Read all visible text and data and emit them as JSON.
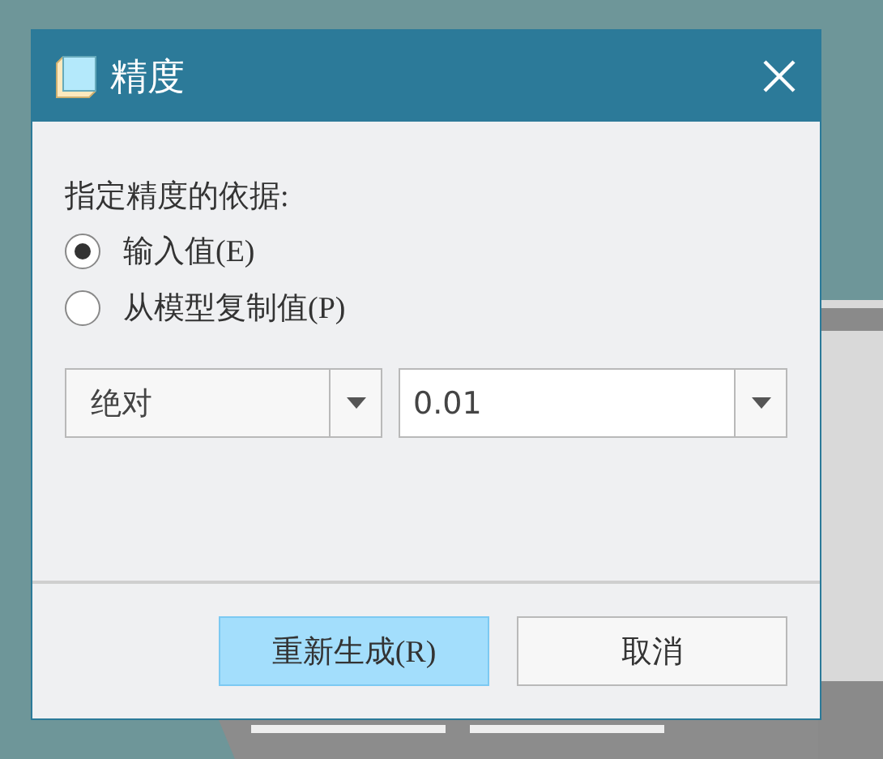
{
  "window": {
    "title": "精度"
  },
  "prompt": "指定精度的依据:",
  "options": [
    {
      "label": "输入值(E)",
      "selected": true
    },
    {
      "label": "从模型复制值(P)",
      "selected": false
    }
  ],
  "type_dropdown": {
    "value": "绝对"
  },
  "value_field": {
    "value": "0.01"
  },
  "buttons": [
    {
      "label": "重新生成(R)",
      "kind": "default"
    },
    {
      "label": "取消",
      "kind": "normal"
    }
  ]
}
